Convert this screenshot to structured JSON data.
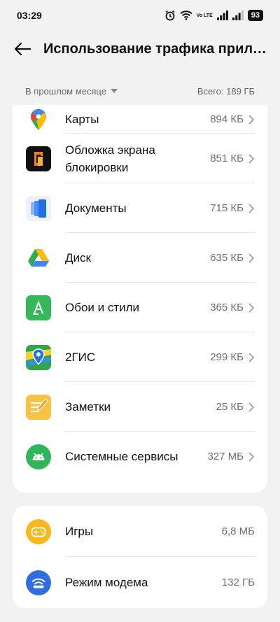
{
  "status": {
    "time": "03:29",
    "network": "Vo LTE",
    "battery": "93"
  },
  "header": {
    "title": "Использование трафика прило…"
  },
  "filter": {
    "period": "В прошлом месяце",
    "total": "Всего: 189 ГБ"
  },
  "apps": [
    {
      "name": "Карты",
      "value": "894 КБ",
      "icon": "google-maps-icon"
    },
    {
      "name": "Обложка экрана блокировки",
      "value": "851 КБ",
      "icon": "lockscreen-cover-icon"
    },
    {
      "name": "Документы",
      "value": "715 КБ",
      "icon": "documents-icon"
    },
    {
      "name": "Диск",
      "value": "635 КБ",
      "icon": "google-drive-icon"
    },
    {
      "name": "Обои и стили",
      "value": "365 КБ",
      "icon": "wallpapers-styles-icon"
    },
    {
      "name": "2ГИС",
      "value": "299 КБ",
      "icon": "2gis-icon"
    },
    {
      "name": "Заметки",
      "value": "25 КБ",
      "icon": "notes-icon"
    },
    {
      "name": "Системные сервисы",
      "value": "327 МБ",
      "icon": "android-system-icon"
    }
  ],
  "other": [
    {
      "name": "Игры",
      "value": "6,8 МБ",
      "icon": "games-icon"
    },
    {
      "name": "Режим модема",
      "value": "132 ГБ",
      "icon": "hotspot-icon"
    }
  ],
  "colors": {
    "background": "#f2f2f2",
    "card": "#ffffff",
    "games": "#f6b81a",
    "hotspot": "#2f6ee0",
    "wallpapers": "#34b85a",
    "android": "#30b65a"
  }
}
